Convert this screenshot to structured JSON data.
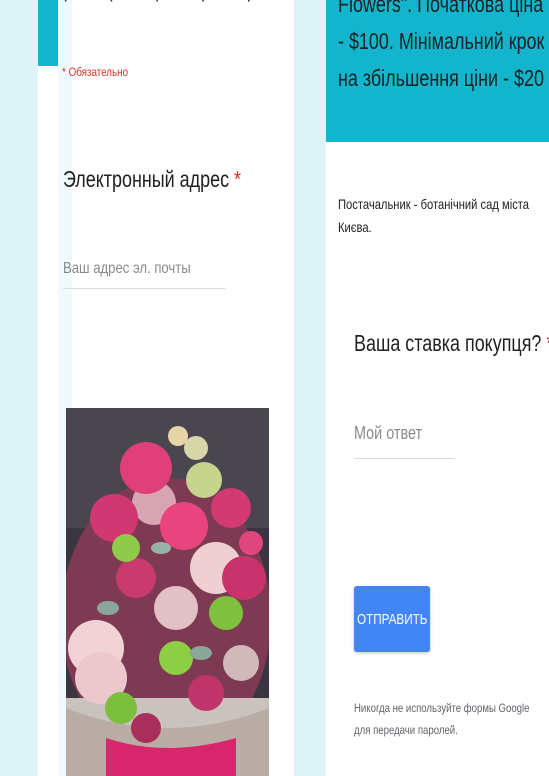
{
  "left_form": {
    "top_cut_text": "· · · · ·",
    "required_note": "* Обязательно",
    "email_question": {
      "label": "Электронный адрес",
      "asterisk": "*",
      "placeholder": "Ваш адрес эл. почты"
    }
  },
  "right_form": {
    "header_text": "Flowers\". Початкова ціна - $100. Мінімальний крок на збільшення ціни - $20",
    "description": "Постачальник - ботанічний сад міста Києва.",
    "bid_question": {
      "label": "Ваша ставка покупця?",
      "asterisk": "*",
      "placeholder": "Мой ответ"
    },
    "submit_label": "ОТПРАВИТЬ",
    "footer_note": "Никогда не используйте формы Google для передачи паролей."
  },
  "colors": {
    "accent": "#12b5cb",
    "button": "#4285f4",
    "required": "#d93025"
  }
}
